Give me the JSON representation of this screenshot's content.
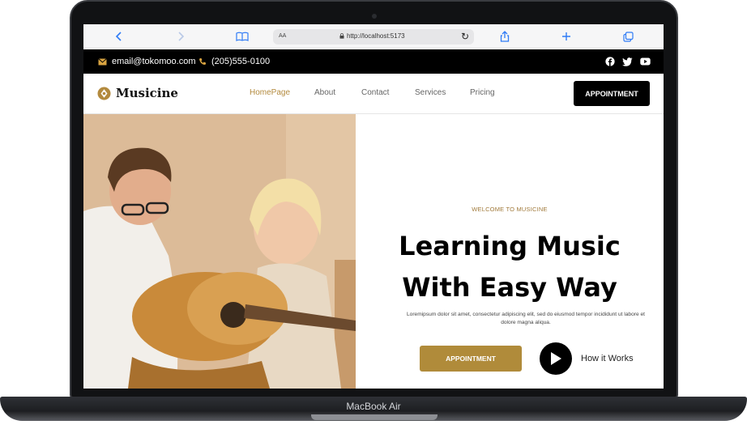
{
  "device": {
    "label": "MacBook Air"
  },
  "browser": {
    "aa_label": "AA",
    "url": "http://localhost:5173"
  },
  "topbar": {
    "email": "email@tokomoo.com",
    "phone": "(205)555-0100",
    "social": [
      "facebook-icon",
      "twitter-icon",
      "youtube-icon"
    ]
  },
  "nav": {
    "logo_text": "Musicine",
    "links": [
      "HomePage",
      "About",
      "Contact",
      "Services",
      "Pricing"
    ],
    "active_link": "HomePage",
    "cta_label": "APPOINTMENT"
  },
  "hero": {
    "kicker": "WELCOME TO MUSICINE",
    "headline_line1": "Learning Music",
    "headline_line2": "With Easy Way",
    "body": "Loremipsum dolor sit amet, consectetur adipiscing elit, sed do eiusmod tempor incididunt ut labore et dolore magna aliqua.",
    "cta_label": "APPOINTMENT",
    "video_label": "How it Works"
  },
  "colors": {
    "accent": "#b08b3a",
    "dark": "#000000",
    "active_link": "#b38a3e"
  }
}
